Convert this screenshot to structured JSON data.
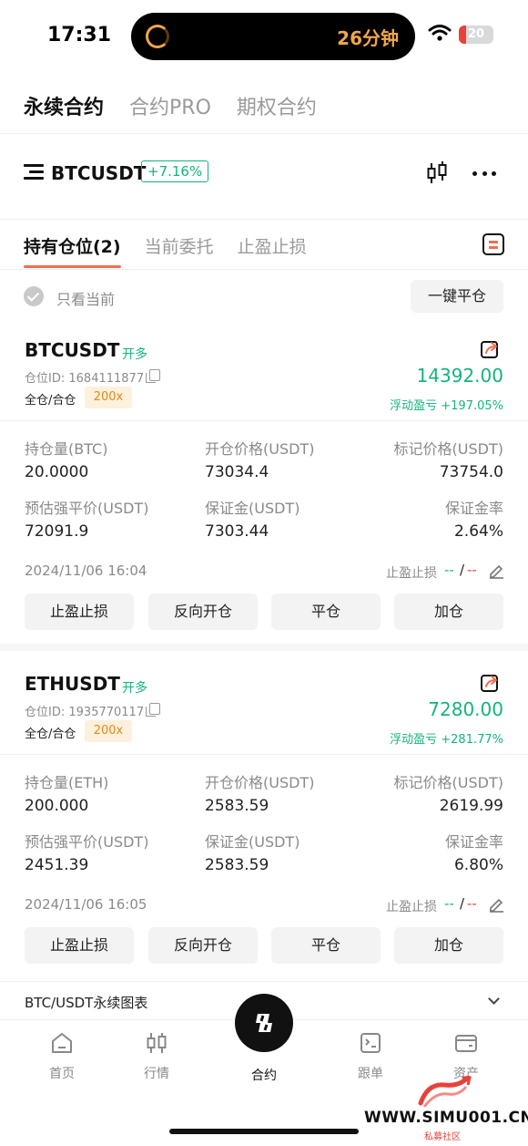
{
  "status_bar": {
    "time": "17:31",
    "timer_text": "26分钟",
    "battery": "20",
    "battery_level": 0.2
  },
  "top_tabs": [
    {
      "label": "永续合约",
      "active": true
    },
    {
      "label": "合约PRO",
      "active": false
    },
    {
      "label": "期权合约",
      "active": false
    }
  ],
  "symbol_bar": {
    "symbol": "BTCUSDT",
    "change": "+7.16%"
  },
  "position_tabs": [
    {
      "label": "持有仓位(2)",
      "active": true
    },
    {
      "label": "当前委托",
      "active": false
    },
    {
      "label": "止盈止损",
      "active": false
    }
  ],
  "filter": {
    "label": "只看当前",
    "close_all": "一键平仓"
  },
  "labels": {
    "position_id": "仓位ID:",
    "margin_mode": "全仓/合仓",
    "pnl": "浮动盈亏",
    "liq_price": "预估强平价(USDT)",
    "entry_price": "开仓价格(USDT)",
    "mark_price": "标记价格(USDT)",
    "margin": "保证金(USDT)",
    "margin_rate": "保证金率",
    "tpsl": "止盈止损",
    "tp": "--",
    "sep": "/",
    "sl": "--"
  },
  "actions": [
    "止盈止损",
    "反向开仓",
    "平仓",
    "加仓"
  ],
  "positions": [
    {
      "symbol": "BTCUSDT",
      "side": "开多",
      "position_id": "1684111877",
      "leverage": "200x",
      "pnl_value": "14392.00",
      "pnl_pct": "+197.05%",
      "size_label": "持仓量(BTC)",
      "size": "20.0000",
      "entry_price": "73034.4",
      "mark_price": "73754.0",
      "liq_price": "72091.9",
      "margin": "7303.44",
      "margin_rate": "2.64%",
      "date": "2024/11/06 16:04"
    },
    {
      "symbol": "ETHUSDT",
      "side": "开多",
      "position_id": "1935770117",
      "leverage": "200x",
      "pnl_value": "7280.00",
      "pnl_pct": "+281.77%",
      "size_label": "持仓量(ETH)",
      "size": "200.000",
      "entry_price": "2583.59",
      "mark_price": "2619.99",
      "liq_price": "2451.39",
      "margin": "2583.59",
      "margin_rate": "6.80%",
      "date": "2024/11/06 16:05"
    }
  ],
  "chart_bar": {
    "title": "BTC/USDT永续图表"
  },
  "bottom_nav": [
    {
      "label": "首页",
      "icon": "home-icon",
      "active": false
    },
    {
      "label": "行情",
      "icon": "candlestick-icon",
      "active": false
    },
    {
      "label": "合约",
      "icon": "contract-icon",
      "active": true
    },
    {
      "label": "跟单",
      "icon": "copy-trade-icon",
      "active": false
    },
    {
      "label": "资产",
      "icon": "wallet-icon",
      "active": false
    }
  ],
  "watermark": {
    "url": "WWW.SIMU001.CN",
    "sub": "私募社区"
  },
  "colors": {
    "green": "#14b37d",
    "red": "#e8413a",
    "accent": "#f26d4f",
    "leverage_bg": "#fdf0dc"
  }
}
